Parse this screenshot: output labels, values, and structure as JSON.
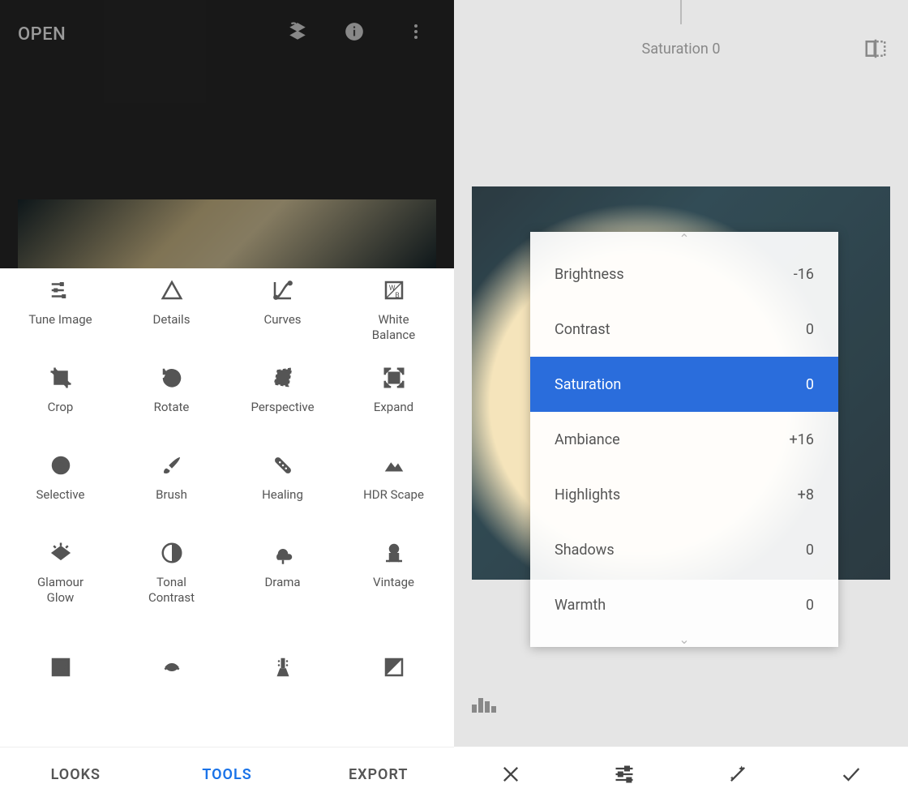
{
  "left": {
    "open_label": "OPEN",
    "tabs": {
      "looks": "LOOKS",
      "tools": "TOOLS",
      "export": "EXPORT",
      "active": "tools"
    },
    "tools": [
      {
        "id": "tune-image",
        "label": "Tune Image"
      },
      {
        "id": "details",
        "label": "Details"
      },
      {
        "id": "curves",
        "label": "Curves"
      },
      {
        "id": "white-balance",
        "label": "White\nBalance"
      },
      {
        "id": "crop",
        "label": "Crop"
      },
      {
        "id": "rotate",
        "label": "Rotate"
      },
      {
        "id": "perspective",
        "label": "Perspective"
      },
      {
        "id": "expand",
        "label": "Expand"
      },
      {
        "id": "selective",
        "label": "Selective"
      },
      {
        "id": "brush",
        "label": "Brush"
      },
      {
        "id": "healing",
        "label": "Healing"
      },
      {
        "id": "hdr-scape",
        "label": "HDR Scape"
      },
      {
        "id": "glamour-glow",
        "label": "Glamour\nGlow"
      },
      {
        "id": "tonal-contrast",
        "label": "Tonal\nContrast"
      },
      {
        "id": "drama",
        "label": "Drama"
      },
      {
        "id": "vintage",
        "label": "Vintage"
      },
      {
        "id": "grainy-film",
        "label": "Grainy Film"
      },
      {
        "id": "retrolux",
        "label": "Retrolux"
      },
      {
        "id": "grunge",
        "label": "Grunge"
      },
      {
        "id": "bw",
        "label": "Black & White"
      }
    ]
  },
  "right": {
    "header": "Saturation 0",
    "selected": "Saturation",
    "adjustments": [
      {
        "name": "Brightness",
        "value": "-16"
      },
      {
        "name": "Contrast",
        "value": "0"
      },
      {
        "name": "Saturation",
        "value": "0"
      },
      {
        "name": "Ambiance",
        "value": "+16"
      },
      {
        "name": "Highlights",
        "value": "+8"
      },
      {
        "name": "Shadows",
        "value": "0"
      },
      {
        "name": "Warmth",
        "value": "0"
      }
    ]
  }
}
